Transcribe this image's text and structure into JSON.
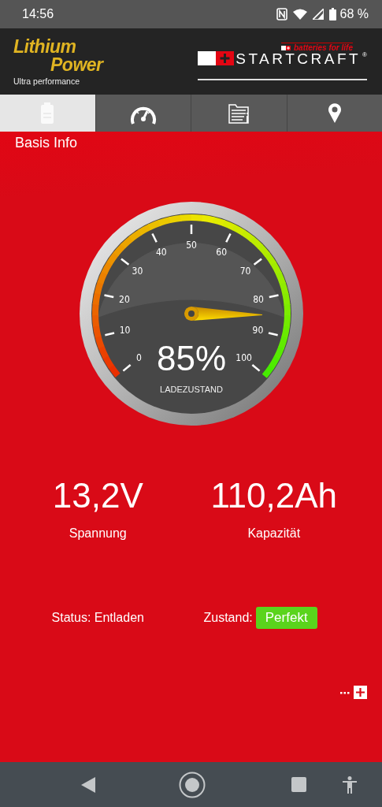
{
  "status_bar": {
    "time": "14:56",
    "battery": "68 %"
  },
  "header": {
    "brand_line_1": "Lithium",
    "brand_line_2": "Power",
    "tagline": "Ultra performance",
    "slogan": "batteries for life",
    "logo": "STARTCRAFT",
    "registered": "®"
  },
  "tabs": [
    {
      "kind": "battery",
      "selected": true
    },
    {
      "kind": "speedometer",
      "selected": false
    },
    {
      "kind": "documents",
      "selected": false
    },
    {
      "kind": "location",
      "selected": false
    }
  ],
  "section_title": "Basis Info",
  "gauge": {
    "ticks": [
      "0",
      "10",
      "20",
      "30",
      "40",
      "50",
      "60",
      "70",
      "80",
      "90",
      "100"
    ],
    "value_text": "85%",
    "caption": "LADEZUSTAND"
  },
  "stats": [
    {
      "value": "13,2V",
      "label": "Spannung"
    },
    {
      "value": "110,2Ah",
      "label": "Kapazität"
    }
  ],
  "status": {
    "text": "Status: Entladen",
    "condition_label": "Zustand:",
    "condition": "Perfekt"
  }
}
